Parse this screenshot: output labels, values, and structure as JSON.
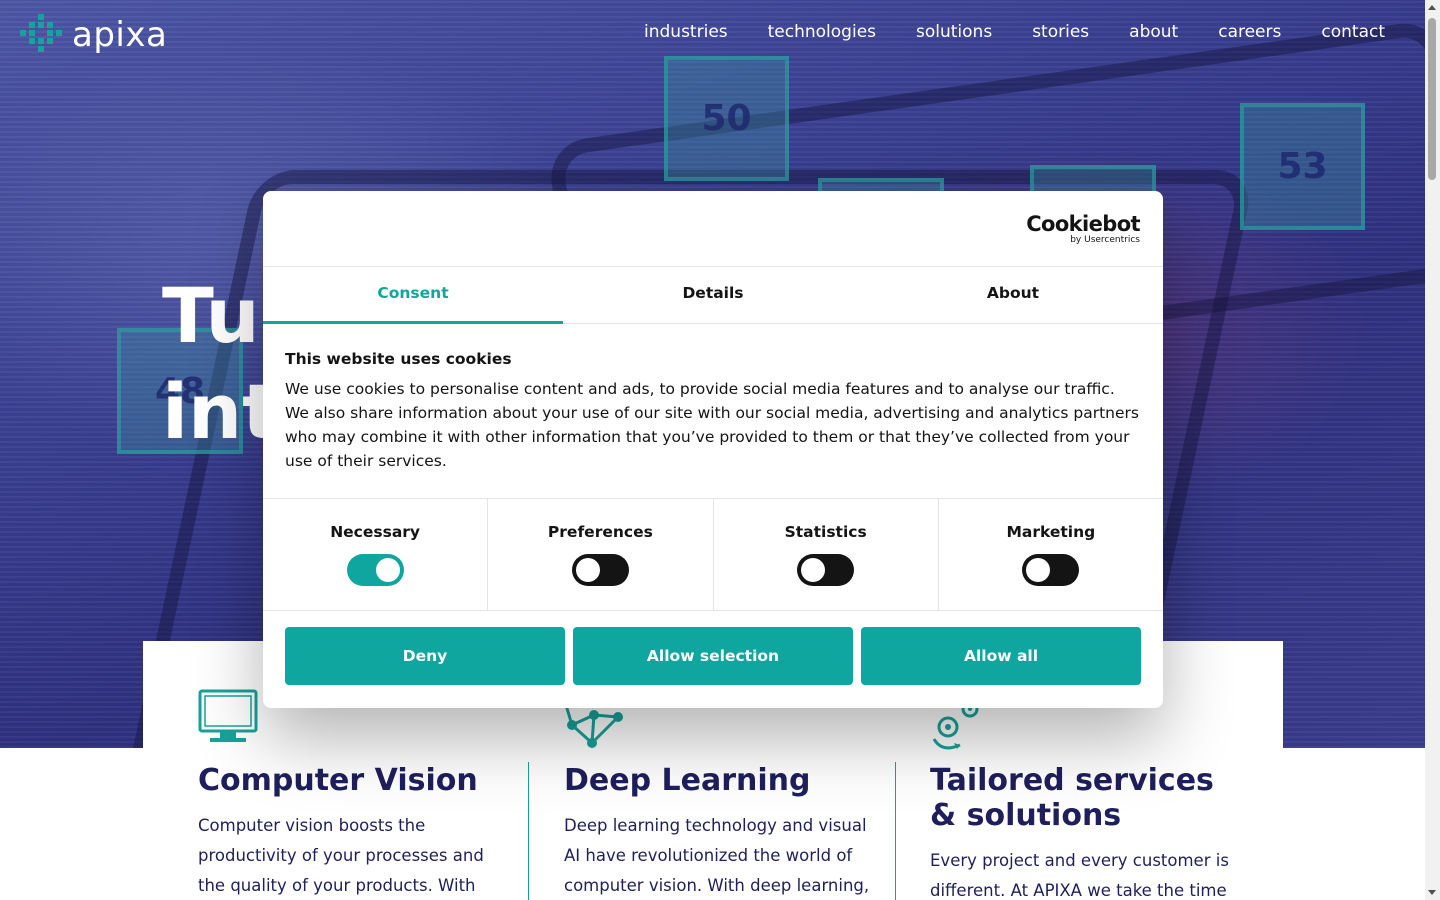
{
  "nav": {
    "logo_text": "apixa",
    "items": [
      {
        "label": "industries"
      },
      {
        "label": "technologies"
      },
      {
        "label": "solutions"
      },
      {
        "label": "stories"
      },
      {
        "label": "about"
      },
      {
        "label": "careers"
      },
      {
        "label": "contact"
      }
    ]
  },
  "hero": {
    "title_visible": "Tu\nint",
    "box_numbers": [
      "50",
      "53",
      "48"
    ]
  },
  "cards": [
    {
      "icon": "monitor-icon",
      "title": "Computer Vision",
      "text": "Computer vision boosts the productivity of your processes and the quality of your products. With more"
    },
    {
      "icon": "neural-network-icon",
      "title": "Deep Learning",
      "text": "Deep learning technology and visual AI have revolutionized the world of computer vision. With deep learning, a"
    },
    {
      "icon": "gears-icon",
      "title": "Tailored services & solutions",
      "text": "Every project and every customer is different. At APIXA we take the time to"
    }
  ],
  "cookie_dialog": {
    "brand": "Cookiebot",
    "brand_sub": "by Usercentrics",
    "tabs": [
      {
        "label": "Consent",
        "active": true
      },
      {
        "label": "Details",
        "active": false
      },
      {
        "label": "About",
        "active": false
      }
    ],
    "heading": "This website uses cookies",
    "body": "We use cookies to personalise content and ads, to provide social media features and to analyse our traffic. We also share information about your use of our site with our social media, advertising and analytics partners who may combine it with other information that you’ve provided to them or that they’ve collected from your use of their services.",
    "preferences": [
      {
        "label": "Necessary",
        "on": true
      },
      {
        "label": "Preferences",
        "on": false
      },
      {
        "label": "Statistics",
        "on": false
      },
      {
        "label": "Marketing",
        "on": false
      }
    ],
    "buttons": {
      "deny": "Deny",
      "allow_selection": "Allow selection",
      "allow_all": "Allow all"
    },
    "accent_color": "#0ea69e"
  },
  "colors": {
    "brand_teal": "#17a39a",
    "heading_navy": "#1e1f5c"
  }
}
